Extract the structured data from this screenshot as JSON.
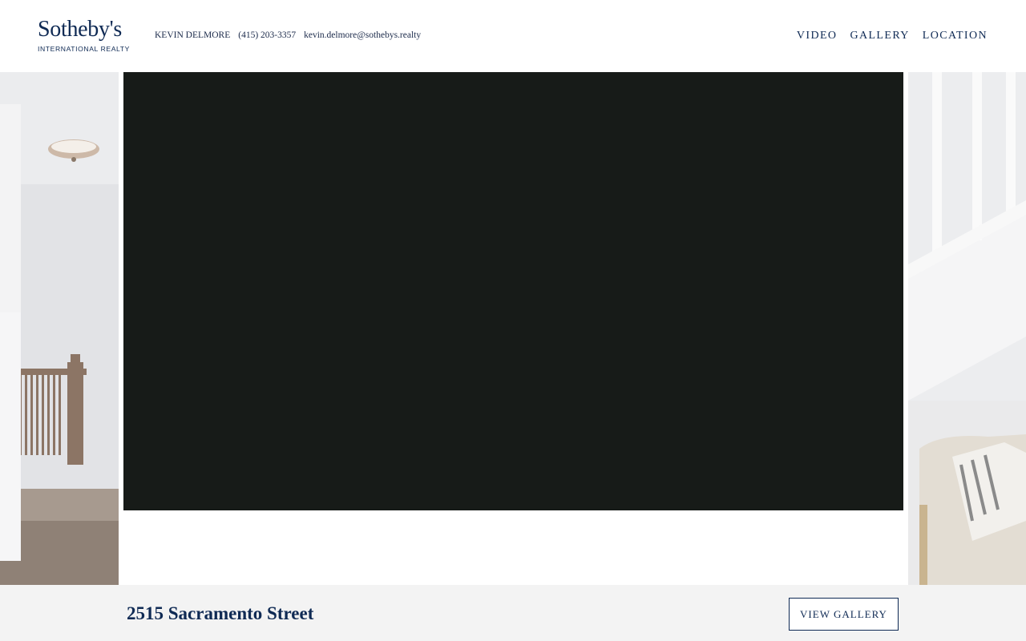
{
  "brand": {
    "name": "Sotheby's",
    "tagline": "INTERNATIONAL REALTY",
    "color": "#0f2a54"
  },
  "contact": {
    "agent": "KEVIN DELMORE",
    "phone": "(415) 203-3357",
    "email": "kevin.delmore@sothebys.realty"
  },
  "nav": [
    {
      "label": "VIDEO"
    },
    {
      "label": "GALLERY"
    },
    {
      "label": "LOCATION"
    }
  ],
  "video": {
    "background": "#171b18"
  },
  "side_images": {
    "left": "interior-hallway-with-railing",
    "right": "staircase-and-armchair"
  },
  "footer": {
    "address": "2515 Sacramento Street",
    "view_gallery_label": "VIEW GALLERY",
    "background": "#f3f3f3"
  }
}
